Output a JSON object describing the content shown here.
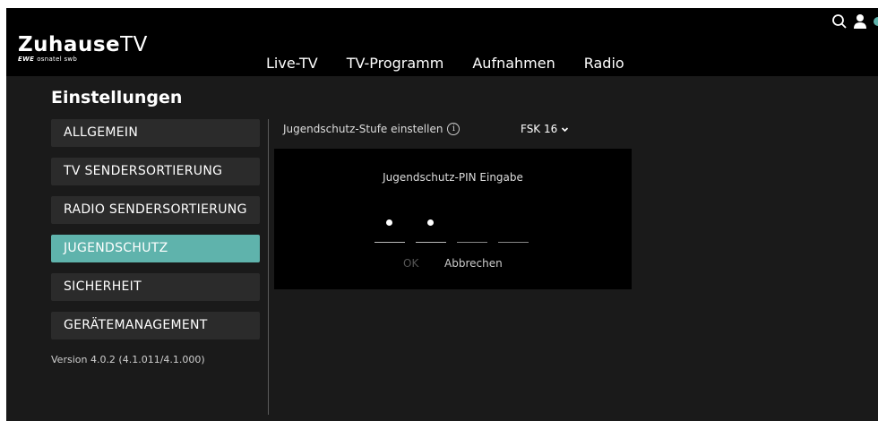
{
  "header": {
    "logo_main": "Zuhause",
    "logo_tv": "TV",
    "logo_sub_brand": "EWE",
    "logo_sub_rest": "osnatel swb",
    "nav": [
      {
        "label": "Live-TV"
      },
      {
        "label": "TV-Programm"
      },
      {
        "label": "Aufnahmen"
      },
      {
        "label": "Radio"
      }
    ]
  },
  "sidebar": {
    "title": "Einstellungen",
    "items": [
      {
        "label": "ALLGEMEIN",
        "active": false
      },
      {
        "label": "TV SENDERSORTIERUNG",
        "active": false
      },
      {
        "label": "RADIO SENDERSORTIERUNG",
        "active": false
      },
      {
        "label": "JUGENDSCHUTZ",
        "active": true
      },
      {
        "label": "SICHERHEIT",
        "active": false
      },
      {
        "label": "GERÄTEMANAGEMENT",
        "active": false
      }
    ],
    "version": "Version 4.0.2 (4.1.011/4.1.000)"
  },
  "content": {
    "setting_label": "Jugendschutz-Stufe einstellen",
    "info_glyph": "i",
    "fsk_value": "FSK 16",
    "dropdown_glyph": "⌄"
  },
  "dialog": {
    "title": "Jugendschutz-PIN Eingabe",
    "pin_filled": [
      true,
      true,
      false,
      false
    ],
    "ok_label": "OK",
    "cancel_label": "Abbrechen"
  },
  "colors": {
    "accent": "#5fb3ac",
    "background": "#1a1a1a",
    "menu_item": "#2b2b2b"
  }
}
